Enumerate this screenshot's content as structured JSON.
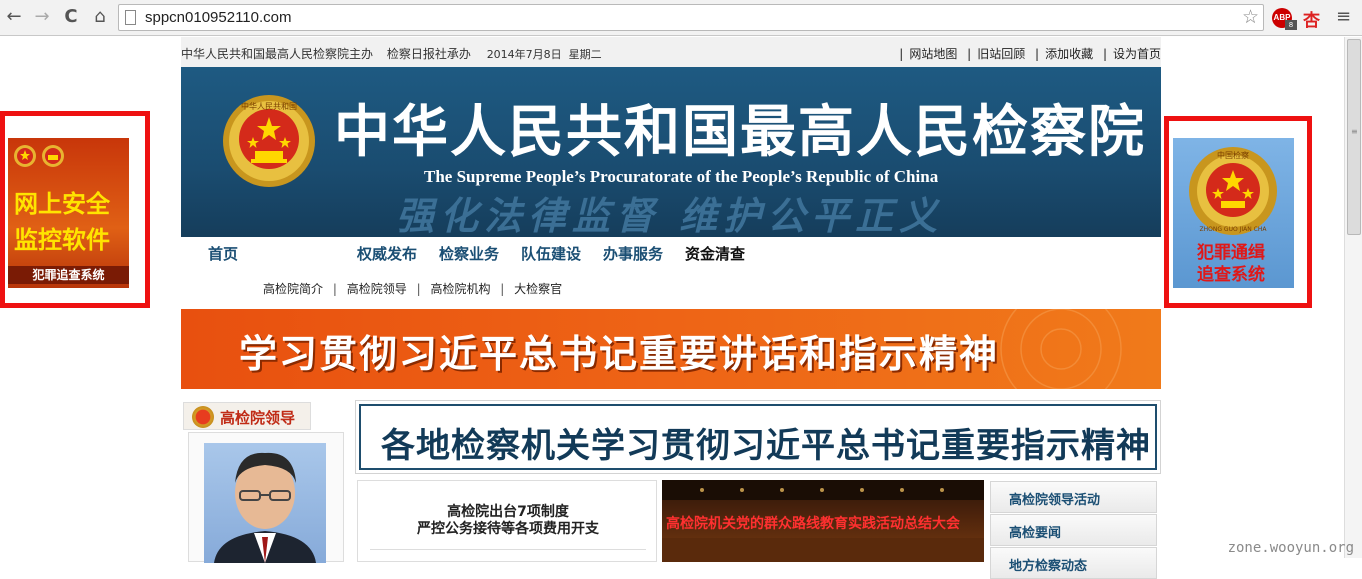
{
  "browser": {
    "url": "sppcn010952110.com",
    "back_icon": "←",
    "forward_icon": "→",
    "reload_icon": "C",
    "home_icon": "⌂",
    "star_icon": "☆",
    "adblock_label": "ABP",
    "adblock_count": "8",
    "extension_label": "杏",
    "menu_icon": "≡"
  },
  "topbar": {
    "host_text": "中华人民共和国最高人民检察院主办",
    "publisher_text": "检察日报社承办",
    "date_text": "2014年7月8日  星期二",
    "links": [
      "网站地图",
      "旧站回顾",
      "添加收藏",
      "设为首页"
    ]
  },
  "banner": {
    "title": "中华人民共和国最高人民检察院",
    "subtitle": "The Supreme People’s Procuratorate of the People’s Republic of China",
    "watermark": "强化法律监督  维护公平正义",
    "emblem_text": "中华人民共和国"
  },
  "mainnav": {
    "items": [
      "首页",
      "权威发布",
      "检察业务",
      "队伍建设",
      "办事服务",
      "资金清查"
    ]
  },
  "subnav": {
    "items": [
      "高检院简介",
      "高检院领导",
      "高检院机构",
      "大检察官"
    ]
  },
  "promo": {
    "text": "学习贯彻习近平总书记重要讲话和指示精神"
  },
  "leaders": {
    "tab_label": "高检院领导"
  },
  "headline": {
    "text": "各地检察机关学习贯彻习近平总书记重要指示精神"
  },
  "news": {
    "line1": "高检院出台7项制度",
    "line2": "严控公务接待等各项费用开支"
  },
  "photo": {
    "caption": "高检院机关党的群众路线教育实践活动总结大会"
  },
  "sidebar": {
    "links": [
      "高检院领导活动",
      "高检要闻",
      "地方检察动态"
    ]
  },
  "ads": {
    "left": {
      "line1": "网上安全",
      "line2": "监控软件",
      "line3": "犯罪追查系统"
    },
    "right": {
      "emblem_text": "中国检察",
      "emblem_ring": "ZHONG GUO JIAN CHA",
      "line1": "犯罪通缉",
      "line2": "追查系统"
    }
  },
  "watermark": "zone.wooyun.org",
  "colors": {
    "banner_blue": "#1a4c70",
    "promo_orange": "#ee6416",
    "ad_border_red": "#ee1111",
    "nav_blue": "#1b4f74"
  }
}
